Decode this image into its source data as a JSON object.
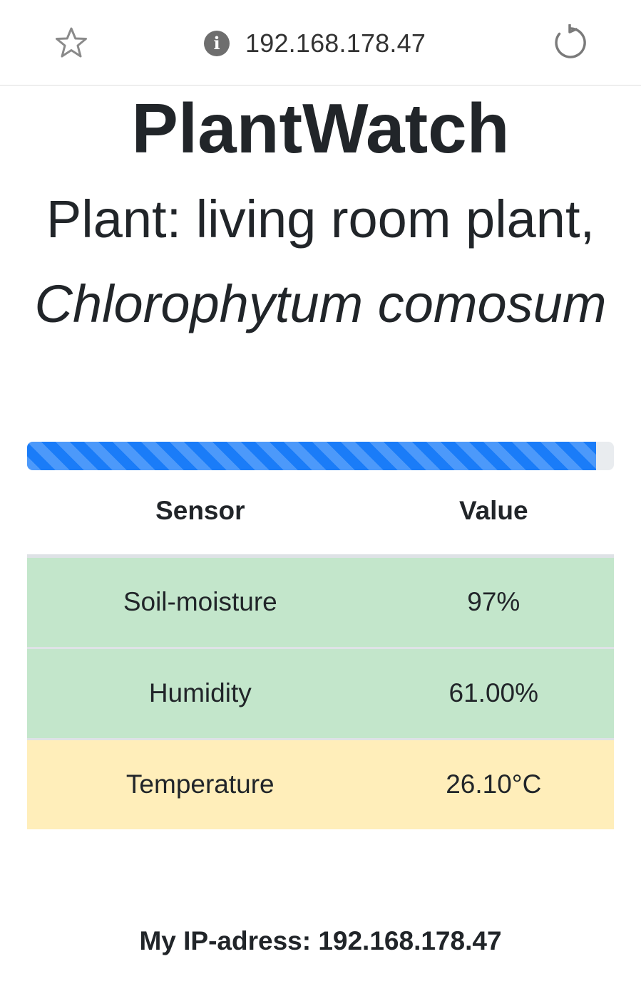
{
  "browser": {
    "url": "192.168.178.47",
    "bookmark_icon": "star-outline-icon",
    "info_icon": "info-circle-icon",
    "reload_icon": "reload-icon"
  },
  "page": {
    "title": "PlantWatch",
    "subtitle_prefix": "Plant: living room plant,",
    "subtitle_species": "Chlorophytum comosum"
  },
  "progress": {
    "value_percent": 97,
    "color": "#1a7cf8",
    "style": "striped"
  },
  "table": {
    "headers": {
      "sensor": "Sensor",
      "value": "Value"
    },
    "rows": [
      {
        "sensor": "Soil-moisture",
        "value": "97%",
        "status": "success",
        "color": "#c3e6cb"
      },
      {
        "sensor": "Humidity",
        "value": "61.00%",
        "status": "success",
        "color": "#c3e6cb"
      },
      {
        "sensor": "Temperature",
        "value": "26.10°C",
        "status": "warning",
        "color": "#ffeeba"
      }
    ]
  },
  "footer": {
    "ip_text": "My IP-adress: 192.168.178.47"
  }
}
